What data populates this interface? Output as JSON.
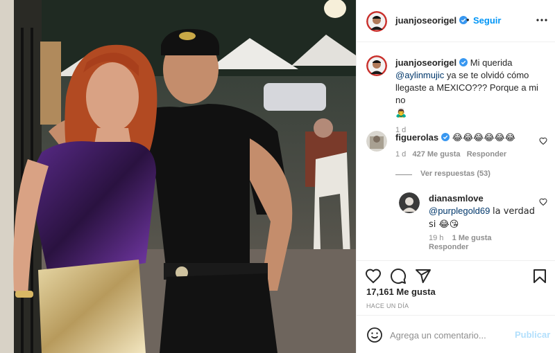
{
  "post": {
    "author": "juanjoseorigel",
    "follow_label": "Seguir",
    "dot": "•",
    "caption": {
      "mention": "@aylinmujic",
      "text_before": "Mi querida",
      "text_after": "ya se te olvidó cómo llegaste a MEXICO??? Porque a mi no",
      "emoji": "🙇‍♂️",
      "age": "1 d"
    },
    "comments": [
      {
        "user": "figuerolas",
        "text": "😂😂😂😂😂😂",
        "age": "1 d",
        "likes": "427 Me gusta",
        "reply_label": "Responder",
        "view_replies": "Ver respuestas (53)"
      },
      {
        "user": "dianasmlove",
        "mention": "@purplegold69",
        "text": "la verdad si 😂😘",
        "age": "19 h",
        "likes": "1 Me gusta",
        "reply_label": "Responder"
      }
    ],
    "likes_count": "17,161 Me gusta",
    "timestamp": "HACE UN DÍA",
    "comment_placeholder": "Agrega un comentario...",
    "publish_label": "Publicar"
  },
  "colors": {
    "accent": "#0095f6",
    "link": "#00376b",
    "muted": "#8e8e8e",
    "publish_disabled": "#b2dffc",
    "border": "#efefef"
  },
  "icons": [
    "verified-badge-icon",
    "more-options-icon",
    "heart-icon",
    "comment-icon",
    "share-icon",
    "bookmark-icon",
    "emoji-icon"
  ]
}
